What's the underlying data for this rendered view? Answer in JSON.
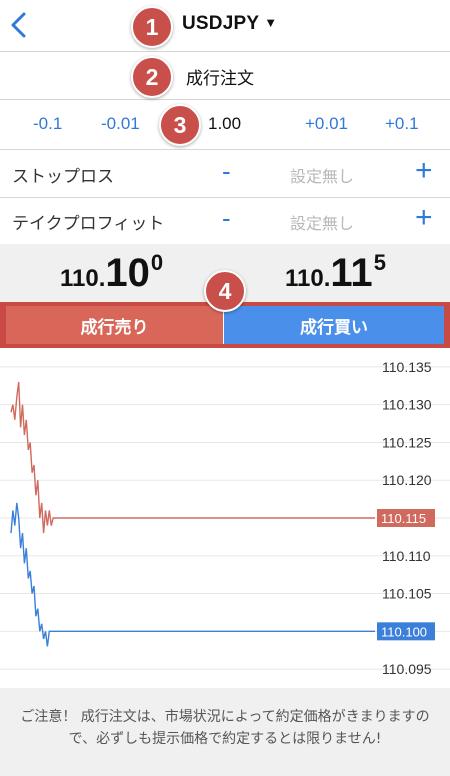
{
  "header": {
    "symbol": "USDJPY",
    "caret": "▼"
  },
  "badges": [
    "1",
    "2",
    "3",
    "4"
  ],
  "order_type": {
    "label": "成行注文"
  },
  "lot": {
    "minus_01": "-0.1",
    "minus_001": "-0.01",
    "value": "1.00",
    "plus_001": "+0.01",
    "plus_01": "+0.1"
  },
  "stop_loss": {
    "label": "ストップロス",
    "minus": "-",
    "value": "設定無し",
    "plus": "+"
  },
  "take_profit": {
    "label": "テイクプロフィット",
    "minus": "-",
    "value": "設定無し",
    "plus": "+"
  },
  "prices": {
    "bid": {
      "prefix": "110.",
      "main": "10",
      "pip": "0"
    },
    "ask": {
      "prefix": "110.",
      "main": "11",
      "pip": "5"
    }
  },
  "buttons": {
    "sell": "成行売り",
    "buy": "成行買い"
  },
  "colors": {
    "accent_blue": "#2f7ad8",
    "sell_red": "#d8675a",
    "buy_blue": "#4a8fe9",
    "badge_red": "#c9504a",
    "ask_line": "#d06a5e",
    "bid_line": "#3b7fd9"
  },
  "chart_data": {
    "type": "line",
    "ylim": [
      110.0925,
      110.1375
    ],
    "y_ticks": [
      "110.135",
      "110.130",
      "110.125",
      "110.120",
      "110.115",
      "110.110",
      "110.105",
      "110.100",
      "110.095"
    ],
    "series": [
      {
        "values": [
          110.129,
          110.13,
          110.128,
          110.131,
          110.133,
          110.127,
          110.13,
          110.126,
          110.128,
          110.124,
          110.125,
          110.121,
          110.122,
          110.118,
          110.12,
          110.115,
          110.117,
          110.113,
          110.116,
          110.114,
          110.116,
          110.114,
          110.115,
          110.115,
          110.115,
          110.115
        ]
      },
      {
        "values": [
          110.113,
          110.116,
          110.114,
          110.117,
          110.115,
          110.111,
          110.113,
          110.109,
          110.111,
          110.107,
          110.108,
          110.105,
          110.106,
          110.102,
          110.103,
          110.1,
          110.101,
          110.099,
          110.1,
          110.098,
          110.1,
          110.1,
          110.1,
          110.1,
          110.1,
          110.1
        ]
      }
    ],
    "last_tags": [
      "110.115",
      "110.100"
    ]
  },
  "notice": {
    "text": "ご注意！ 成行注文は、市場状況によって約定価格がきまりますので、必ずしも提示価格で約定するとは限りません!"
  }
}
